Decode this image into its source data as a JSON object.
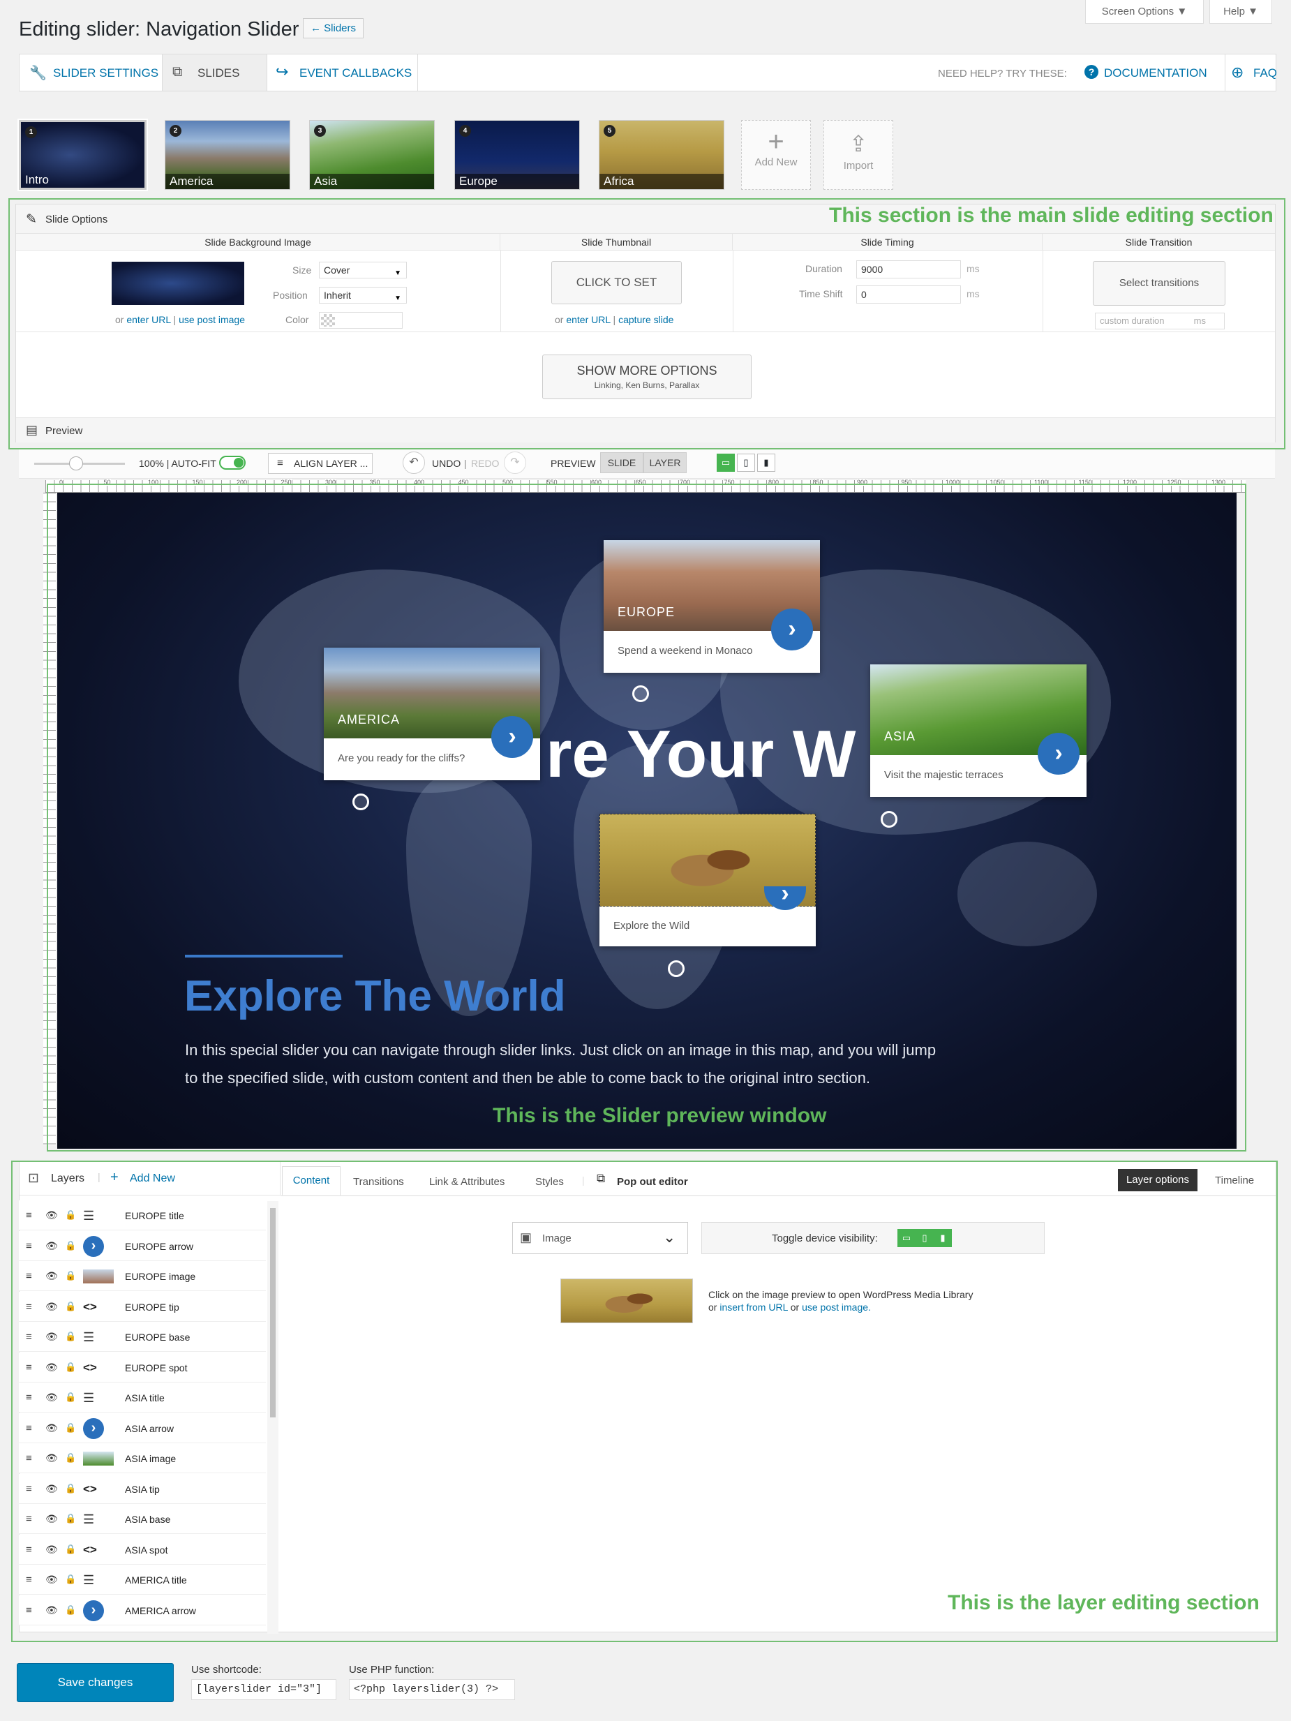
{
  "header": {
    "title": "Editing slider: Navigation Slider",
    "back_label": "← Sliders",
    "screen_options": "Screen Options ▼",
    "help": "Help ▼"
  },
  "toolbar": {
    "slider_settings": "SLIDER SETTINGS",
    "slides": "SLIDES",
    "event_callbacks": "EVENT CALLBACKS",
    "need_help": "NEED HELP? TRY THESE:",
    "documentation": "DOCUMENTATION",
    "faq": "FAQ"
  },
  "slides": [
    {
      "num": "1",
      "label": "Intro"
    },
    {
      "num": "2",
      "label": "America"
    },
    {
      "num": "3",
      "label": "Asia"
    },
    {
      "num": "4",
      "label": "Europe"
    },
    {
      "num": "5",
      "label": "Africa"
    }
  ],
  "slide_actions": {
    "add_new": "Add New",
    "import": "Import"
  },
  "annotations": {
    "main": "This section is the main slide editing section",
    "preview": "This is the Slider preview window",
    "layers": "This is the layer editing section"
  },
  "slide_options": {
    "title": "Slide Options",
    "bg": {
      "header": "Slide Background Image",
      "size_label": "Size",
      "size_value": "Cover",
      "position_label": "Position",
      "position_value": "Inherit",
      "color_label": "Color",
      "or": "or",
      "enter_url": "enter URL",
      "sep": "|",
      "use_post_image": "use post image"
    },
    "thumb": {
      "header": "Slide Thumbnail",
      "click_to_set": "CLICK TO SET",
      "or": "or",
      "enter_url": "enter URL",
      "sep": "|",
      "capture": "capture slide"
    },
    "timing": {
      "header": "Slide Timing",
      "duration_label": "Duration",
      "duration_value": "9000",
      "timeshift_label": "Time Shift",
      "timeshift_value": "0",
      "unit": "ms"
    },
    "transition": {
      "header": "Slide Transition",
      "select": "Select transitions",
      "custom_placeholder": "custom duration",
      "unit": "ms"
    },
    "more": {
      "title": "SHOW MORE OPTIONS",
      "sub": "Linking, Ken Burns, Parallax"
    },
    "preview": "Preview"
  },
  "preview_bar": {
    "zoom": "100% | AUTO-FIT",
    "align": "ALIGN LAYER ...",
    "undo": "UNDO",
    "sep": "|",
    "redo": "REDO",
    "preview": "PREVIEW",
    "slide": "SLIDE",
    "layer": "LAYER"
  },
  "ruler": {
    "ticks": [
      "0",
      "50",
      "100",
      "150",
      "200",
      "250",
      "300",
      "350",
      "400",
      "450",
      "500",
      "550",
      "600",
      "650",
      "700",
      "750",
      "800",
      "850",
      "900",
      "950",
      "1000",
      "1050",
      "1100",
      "1150",
      "1200",
      "1250",
      "1300"
    ]
  },
  "canvas": {
    "headline": "Explore The World",
    "body_line1": "In this special slider you can navigate through slider links. Just click on an image in this map, and you will jump",
    "body_line2": "to the specified slide, with custom content and then be able to come back to the original intro section.",
    "bg_heading": "re Your W",
    "europe": {
      "caption": "EUROPE",
      "text": "Spend a weekend in Monaco"
    },
    "america": {
      "caption": "AMERICA",
      "text": "Are you ready for the cliffs?"
    },
    "asia": {
      "caption": "ASIA",
      "text": "Visit the majestic terraces"
    },
    "africa": {
      "text": "Explore the Wild"
    }
  },
  "layers": {
    "title": "Layers",
    "add_new": "Add New",
    "items": [
      {
        "name": "EUROPE title",
        "kind": "text"
      },
      {
        "name": "EUROPE arrow",
        "kind": "arrow"
      },
      {
        "name": "EUROPE image",
        "kind": "image-europe"
      },
      {
        "name": "EUROPE tip",
        "kind": "html"
      },
      {
        "name": "EUROPE base",
        "kind": "text"
      },
      {
        "name": "EUROPE spot",
        "kind": "html"
      },
      {
        "name": "ASIA title",
        "kind": "text"
      },
      {
        "name": "ASIA arrow",
        "kind": "arrow"
      },
      {
        "name": "ASIA image",
        "kind": "image-asia"
      },
      {
        "name": "ASIA tip",
        "kind": "html"
      },
      {
        "name": "ASIA base",
        "kind": "text"
      },
      {
        "name": "ASIA spot",
        "kind": "html"
      },
      {
        "name": "AMERICA title",
        "kind": "text"
      },
      {
        "name": "AMERICA arrow",
        "kind": "arrow"
      }
    ]
  },
  "editor": {
    "tabs": {
      "content": "Content",
      "transitions": "Transitions",
      "link": "Link & Attributes",
      "styles": "Styles",
      "popout": "Pop out editor"
    },
    "layer_options": "Layer options",
    "timeline": "Timeline",
    "type": "Image",
    "device_visibility": "Toggle device visibility:",
    "media_line1": "Click on the image preview to open WordPress Media Library",
    "media_or": "or",
    "media_insert": "insert from URL",
    "media_or2": "or",
    "media_use": "use post image."
  },
  "footer": {
    "save": "Save changes",
    "shortcode_label": "Use shortcode:",
    "shortcode": "[layerslider id=\"3\"]",
    "php_label": "Use PHP function:",
    "php": "<?php layerslider(3) ?>"
  },
  "colors": {
    "accent": "#0073aa",
    "annotation": "#5fb65a",
    "device_green": "#46b450",
    "primary": "#0085ba"
  }
}
